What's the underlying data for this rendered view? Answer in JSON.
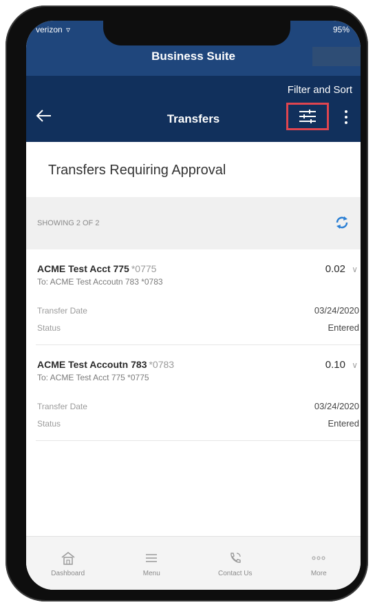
{
  "status_bar": {
    "carrier": "verizon",
    "battery": "95%"
  },
  "app_header": {
    "title": "Business Suite"
  },
  "nav_bar": {
    "annotation": "Filter and Sort",
    "title": "Transfers",
    "back_icon": "arrow-left-icon",
    "filter_icon": "sliders-icon",
    "more_icon": "vertical-dots-icon",
    "highlight_color": "#e0454f"
  },
  "section": {
    "heading": "Transfers Requiring Approval"
  },
  "list_meta": {
    "showing": "SHOWING 2 OF 2",
    "refresh_icon": "refresh-icon"
  },
  "transfers": [
    {
      "name": "ACME Test Acct 775",
      "mask": "*0775",
      "to": "To: ACME Test Accoutn 783 *0783",
      "amount": "0.02",
      "date_label": "Transfer Date",
      "date": "03/24/2020",
      "status_label": "Status",
      "status": "Entered"
    },
    {
      "name": "ACME Test Accoutn 783",
      "mask": "*0783",
      "to": "To: ACME Test Acct 775 *0775",
      "amount": "0.10",
      "date_label": "Transfer Date",
      "date": "03/24/2020",
      "status_label": "Status",
      "status": "Entered"
    }
  ],
  "bottom_nav": {
    "items": [
      {
        "label": "Dashboard",
        "icon": "home-icon"
      },
      {
        "label": "Menu",
        "icon": "hamburger-icon"
      },
      {
        "label": "Contact Us",
        "icon": "phone-icon"
      },
      {
        "label": "More",
        "icon": "horizontal-dots-icon"
      }
    ]
  },
  "colors": {
    "header": "#1f467c",
    "nav_bar": "#11305c",
    "accent": "#2a7fd4"
  }
}
